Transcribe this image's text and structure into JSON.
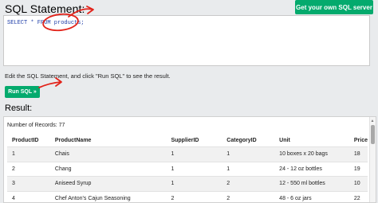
{
  "header": {
    "title": "SQL Statement:",
    "own_server_label": "Get your own SQL server"
  },
  "editor": {
    "sql": "SELECT * FROM products;"
  },
  "instruction": "Edit the SQL Statement, and click \"Run SQL\" to see the result.",
  "run_button_label": "Run SQL »",
  "result": {
    "heading": "Result:",
    "record_count": "Number of Records: 77",
    "columns": [
      "ProductID",
      "ProductName",
      "SupplierID",
      "CategoryID",
      "Unit",
      "Price"
    ],
    "rows": [
      [
        "1",
        "Chais",
        "1",
        "1",
        "10 boxes x 20 bags",
        "18"
      ],
      [
        "2",
        "Chang",
        "1",
        "1",
        "24 - 12 oz bottles",
        "19"
      ],
      [
        "3",
        "Aniseed Syrup",
        "1",
        "2",
        "12 - 550 ml bottles",
        "10"
      ],
      [
        "4",
        "Chef Anton's Cajun Seasoning",
        "2",
        "2",
        "48 - 6 oz jars",
        "22"
      ]
    ]
  },
  "colors": {
    "accent_green": "#04aa6d",
    "annotation_red": "#e2231a"
  }
}
